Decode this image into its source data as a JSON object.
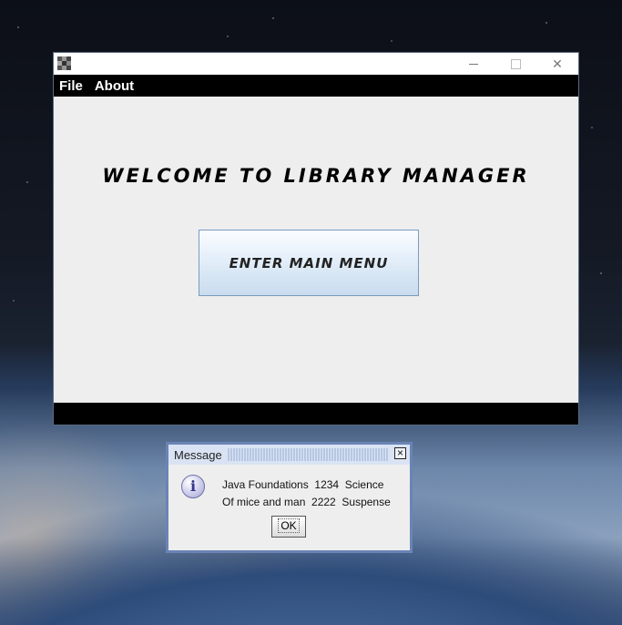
{
  "window": {
    "menu": [
      "File",
      "About"
    ],
    "welcome_text": "WELCOME TO LIBRARY MANAGER",
    "main_button_label": "ENTER MAIN MENU",
    "controls": {
      "minimize": "─",
      "maximize": "☐",
      "close": "✕"
    }
  },
  "dialog": {
    "title": "Message",
    "icon": "info-icon",
    "icon_glyph": "i",
    "close_glyph": "☒",
    "lines": [
      "Java Foundations  1234  Science",
      "Of mice and man  2222  Suspense"
    ],
    "ok_label": "OK"
  },
  "colors": {
    "menubar": "#000000",
    "dialog_border": "#6a84b6",
    "button_gradient_bottom": "#c9dcee"
  }
}
